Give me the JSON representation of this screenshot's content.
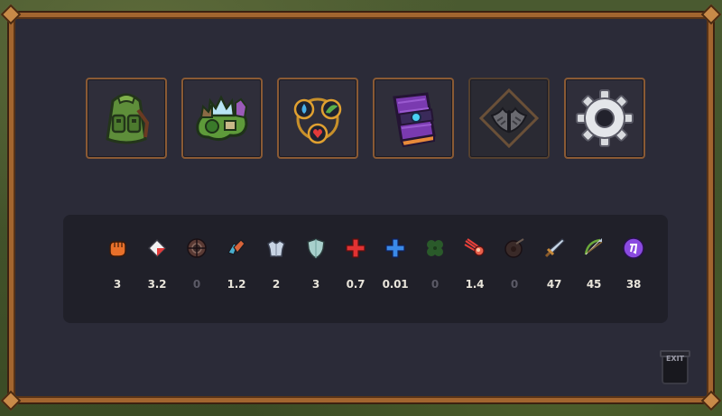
{
  "menu": [
    {
      "name": "inventory",
      "icon": "backpack-icon",
      "enabled": true
    },
    {
      "name": "map",
      "icon": "world-map-icon",
      "enabled": true
    },
    {
      "name": "skills",
      "icon": "skill-orbs-icon",
      "enabled": true
    },
    {
      "name": "spellbook",
      "icon": "spellbook-icon",
      "enabled": true
    },
    {
      "name": "wings",
      "icon": "wings-icon",
      "enabled": false
    },
    {
      "name": "settings",
      "icon": "gear-icon",
      "enabled": true
    }
  ],
  "stats": [
    {
      "icon": "fist-icon",
      "value": "3",
      "color": "#e8702a"
    },
    {
      "icon": "card-icon",
      "value": "3.2",
      "color": "#e84040"
    },
    {
      "icon": "target-icon",
      "value": "0",
      "color": "#6a4a44"
    },
    {
      "icon": "boots-icon",
      "value": "1.2",
      "color": "#d8643a"
    },
    {
      "icon": "armor-icon",
      "value": "2",
      "color": "#b8c6d8"
    },
    {
      "icon": "shield-icon",
      "value": "3",
      "color": "#9ac4c0"
    },
    {
      "icon": "red-cross-icon",
      "value": "0.7",
      "color": "#e23232"
    },
    {
      "icon": "blue-cross-icon",
      "value": "0.01",
      "color": "#3a8ae8"
    },
    {
      "icon": "clover-icon",
      "value": "0",
      "color": "#2a5a2a"
    },
    {
      "icon": "comet-icon",
      "value": "1.4",
      "color": "#e8403a"
    },
    {
      "icon": "round-shield-icon",
      "value": "0",
      "color": "#4a3a34"
    },
    {
      "icon": "sword-icon",
      "value": "47",
      "color": "#b8c8d8"
    },
    {
      "icon": "bow-icon",
      "value": "45",
      "color": "#6aa83a"
    },
    {
      "icon": "magic-orb-icon",
      "value": "38",
      "color": "#8a4ae0"
    }
  ],
  "exit": {
    "label": "EXIT"
  }
}
